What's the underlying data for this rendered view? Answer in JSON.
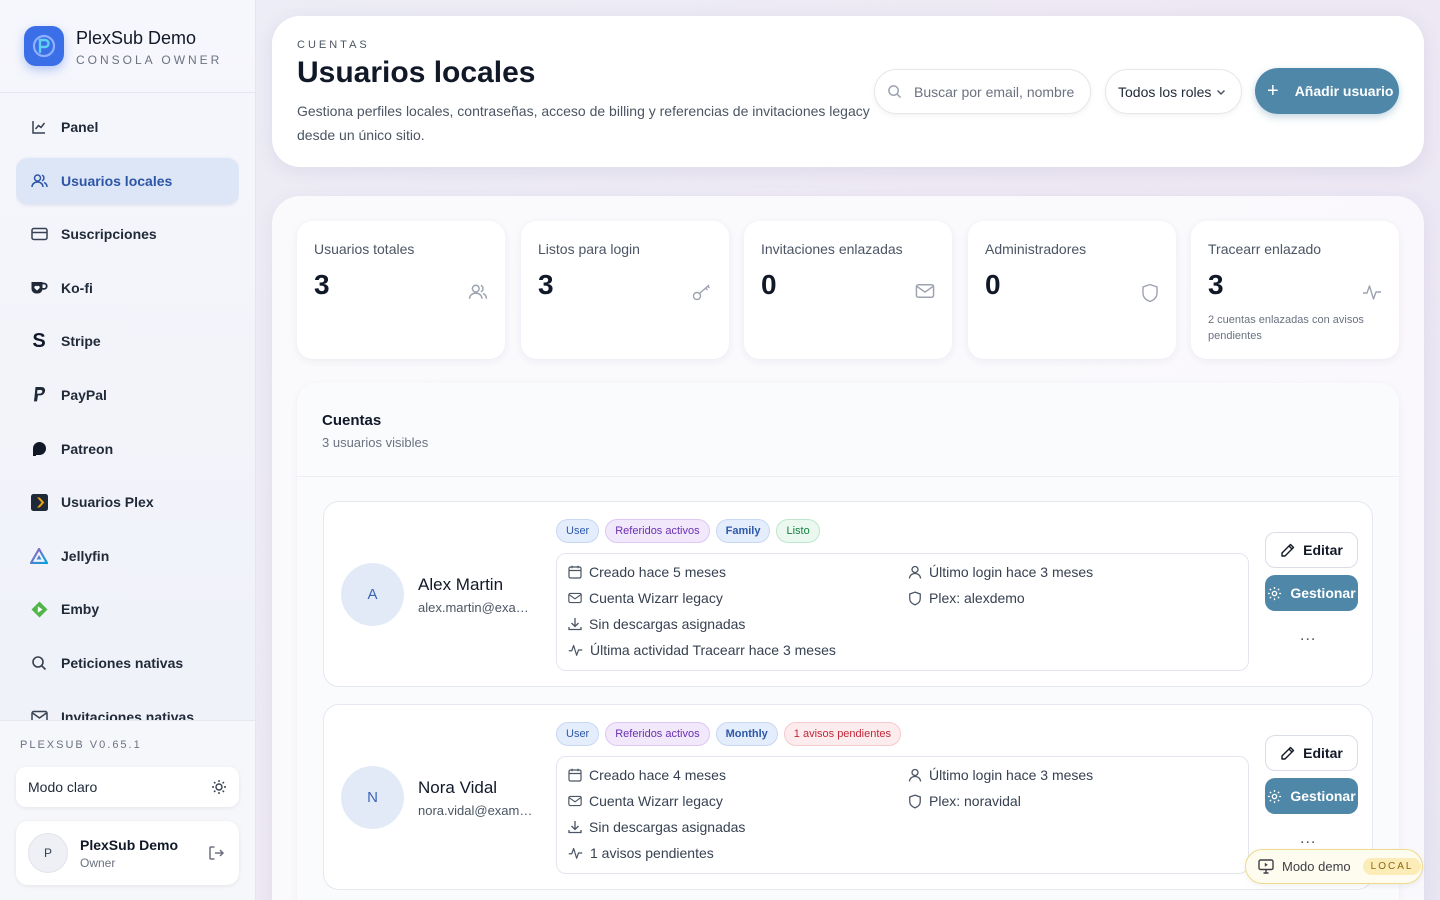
{
  "app": {
    "title": "PlexSub Demo",
    "subtitle": "CONSOLA OWNER",
    "version": "PLEXSUB V0.65.1",
    "accent": "#3b6fe8",
    "primary": "#4f87a8"
  },
  "sidebar": {
    "items": [
      {
        "label": "Panel",
        "icon": "chart-line-icon",
        "active": false
      },
      {
        "label": "Usuarios locales",
        "icon": "users-icon",
        "active": true
      },
      {
        "label": "Suscripciones",
        "icon": "credit-card-icon",
        "active": false
      },
      {
        "label": "Ko-fi",
        "icon": "kofi-icon",
        "active": false
      },
      {
        "label": "Stripe",
        "icon": "stripe-icon",
        "active": false
      },
      {
        "label": "PayPal",
        "icon": "paypal-icon",
        "active": false
      },
      {
        "label": "Patreon",
        "icon": "patreon-icon",
        "active": false
      },
      {
        "label": "Usuarios Plex",
        "icon": "plex-icon",
        "active": false
      },
      {
        "label": "Jellyfin",
        "icon": "jellyfin-icon",
        "active": false
      },
      {
        "label": "Emby",
        "icon": "emby-icon",
        "active": false
      },
      {
        "label": "Peticiones nativas",
        "icon": "search-icon",
        "active": false
      },
      {
        "label": "Invitaciones nativas",
        "icon": "mail-icon",
        "active": false
      }
    ],
    "theme_label": "Modo claro",
    "user": {
      "initial": "P",
      "name": "PlexSub Demo",
      "role": "Owner"
    }
  },
  "header": {
    "kicker": "CUENTAS",
    "title": "Usuarios locales",
    "description": "Gestiona perfiles locales, contraseñas, acceso de billing y referencias de invitaciones legacy desde un único sitio.",
    "search_placeholder": "Buscar por email, nombre",
    "roles_filter": "Todos los roles",
    "add_label": "Añadir usuario"
  },
  "stats": [
    {
      "label": "Usuarios totales",
      "value": "3",
      "icon": "users-icon",
      "sub": ""
    },
    {
      "label": "Listos para login",
      "value": "3",
      "icon": "key-icon",
      "sub": ""
    },
    {
      "label": "Invitaciones enlazadas",
      "value": "0",
      "icon": "mail-icon",
      "sub": ""
    },
    {
      "label": "Administradores",
      "value": "0",
      "icon": "shield-icon",
      "sub": ""
    },
    {
      "label": "Tracearr enlazado",
      "value": "3",
      "icon": "activity-icon",
      "sub": "2 cuentas enlazadas con avisos pendientes"
    }
  ],
  "accounts": {
    "title": "Cuentas",
    "subtitle": "3 usuarios visibles",
    "edit_label": "Editar",
    "manage_label": "Gestionar",
    "more_label": "...",
    "rows": [
      {
        "initial": "A",
        "name": "Alex Martin",
        "email": "alex.martin@example.com",
        "tags": [
          {
            "label": "User",
            "kind": "user"
          },
          {
            "label": "Referidos activos",
            "kind": "ref"
          },
          {
            "label": "Family",
            "kind": "plan"
          },
          {
            "label": "Listo",
            "kind": "ok"
          }
        ],
        "created": "Creado hace 5 meses",
        "account_type": "Cuenta Wizarr legacy",
        "downloads": "Sin descargas asignadas",
        "activity": "Última actividad Tracearr hace 3 meses",
        "last_login": "Último login hace 3 meses",
        "plex": "Plex: alexdemo"
      },
      {
        "initial": "N",
        "name": "Nora Vidal",
        "email": "nora.vidal@example.com",
        "tags": [
          {
            "label": "User",
            "kind": "user"
          },
          {
            "label": "Referidos activos",
            "kind": "ref"
          },
          {
            "label": "Monthly",
            "kind": "plan"
          },
          {
            "label": "1 avisos pendientes",
            "kind": "warn"
          }
        ],
        "created": "Creado hace 4 meses",
        "account_type": "Cuenta Wizarr legacy",
        "downloads": "Sin descargas asignadas",
        "activity": "1 avisos pendientes",
        "last_login": "Último login hace 3 meses",
        "plex": "Plex: noravidal"
      }
    ]
  },
  "demo_badge": {
    "label": "Modo demo",
    "tag": "LOCAL"
  }
}
